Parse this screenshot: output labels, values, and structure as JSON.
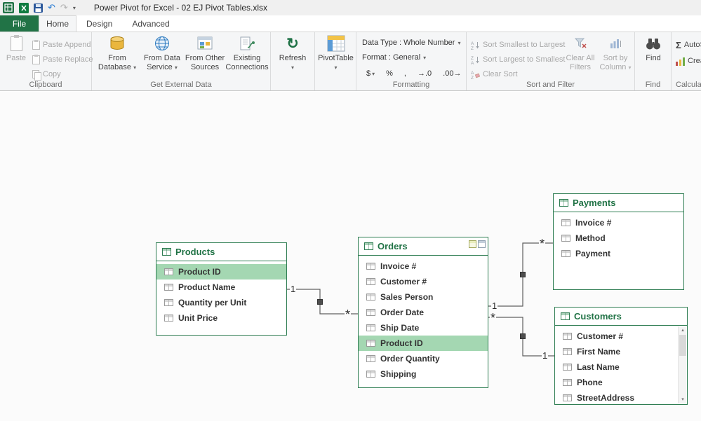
{
  "window": {
    "title": "Power Pivot for Excel - 02 EJ Pivot Tables.xlsx"
  },
  "tabs": {
    "file": "File",
    "home": "Home",
    "design": "Design",
    "advanced": "Advanced"
  },
  "ribbon": {
    "clipboard": {
      "group_label": "Clipboard",
      "paste": "Paste",
      "paste_append": "Paste Append",
      "paste_replace": "Paste Replace",
      "copy": "Copy"
    },
    "external_data": {
      "group_label": "Get External Data",
      "from_database": "From Database",
      "from_data_service": "From Data Service",
      "from_other_sources": "From Other Sources",
      "existing_connections": "Existing Connections"
    },
    "refresh": {
      "label": "Refresh"
    },
    "pivottable": {
      "label": "PivotTable"
    },
    "formatting": {
      "group_label": "Formatting",
      "data_type": "Data Type : Whole Number",
      "format": "Format : General",
      "number_buttons": [
        "$",
        "%",
        ",",
        "→.0",
        ".00→"
      ]
    },
    "sort_filter": {
      "group_label": "Sort and Filter",
      "sort_asc": "Sort Smallest to Largest",
      "sort_desc": "Sort Largest to Smallest",
      "clear_sort": "Clear Sort",
      "clear_filters": "Clear All Filters",
      "sort_by_column": "Sort by Column"
    },
    "find": {
      "group_label": "Find",
      "label": "Find"
    },
    "calculations": {
      "group_label": "Calculations",
      "autosum": "AutoSum",
      "create_kpi": "Create KPI"
    }
  },
  "diagram": {
    "tables": [
      {
        "name": "Products",
        "fields": [
          {
            "label": "Product ID",
            "selected": true
          },
          {
            "label": "Product Name"
          },
          {
            "label": "Quantity per Unit"
          },
          {
            "label": "Unit Price"
          }
        ]
      },
      {
        "name": "Orders",
        "fields": [
          {
            "label": "Invoice #"
          },
          {
            "label": "Customer #"
          },
          {
            "label": "Sales Person"
          },
          {
            "label": "Order Date"
          },
          {
            "label": "Ship Date"
          },
          {
            "label": "Product ID",
            "selected": true
          },
          {
            "label": "Order Quantity"
          },
          {
            "label": "Shipping"
          }
        ]
      },
      {
        "name": "Payments",
        "fields": [
          {
            "label": "Invoice #"
          },
          {
            "label": "Method"
          },
          {
            "label": "Payment"
          }
        ]
      },
      {
        "name": "Customers",
        "fields": [
          {
            "label": "Customer #"
          },
          {
            "label": "First Name"
          },
          {
            "label": "Last Name"
          },
          {
            "label": "Phone"
          },
          {
            "label": "StreetAddress"
          }
        ]
      }
    ],
    "relationships": [
      {
        "from": "Products",
        "to": "Orders",
        "from_card": "1",
        "to_card": "*"
      },
      {
        "from": "Orders",
        "to": "Payments",
        "from_card": "1",
        "to_card": "*"
      },
      {
        "from": "Orders",
        "to": "Customers",
        "from_card": "*",
        "to_card": "1"
      }
    ]
  },
  "colors": {
    "accent_green": "#217346",
    "row_highlight": "#a4d7b2"
  }
}
